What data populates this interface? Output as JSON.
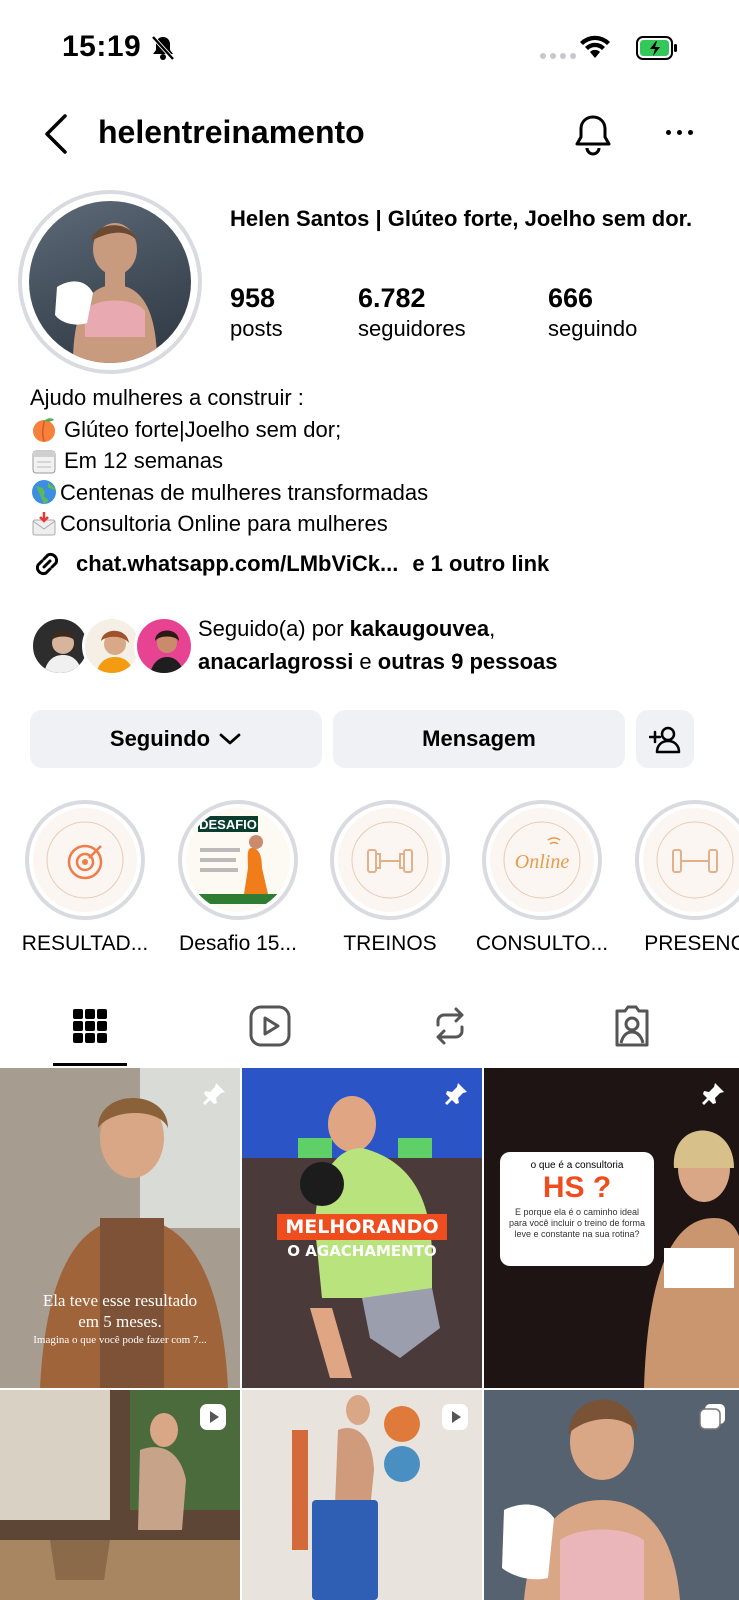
{
  "status_bar": {
    "time": "15:19"
  },
  "header": {
    "username": "helentreinamento"
  },
  "profile": {
    "display_name": "Helen Santos | Glúteo forte, Joelho sem dor.",
    "stats": [
      {
        "value": "958",
        "label": "posts"
      },
      {
        "value": "6.782",
        "label": "seguidores"
      },
      {
        "value": "666",
        "label": "seguindo"
      }
    ],
    "bio": [
      {
        "icon": "peach-emoji",
        "text": "Ajudo mulheres a construir :"
      },
      {
        "icon": "peach-emoji",
        "text": " Glúteo forte|Joelho sem dor;"
      },
      {
        "icon": "calendar-emoji",
        "text": " Em 12 semanas"
      },
      {
        "icon": "globe-emoji",
        "text": "Centenas de mulheres transformadas"
      },
      {
        "icon": "envelope-emoji",
        "text": "Consultoria Online para mulheres"
      }
    ],
    "link": "chat.whatsapp.com/LMbViCk...",
    "link_extra": "e 1 outro link"
  },
  "followed_by": {
    "prefix": "Seguido(a) por ",
    "user1": "kakaugouvea",
    "comma": ",",
    "user2": "anacarlagrossi",
    "middle": " e ",
    "others": "outras 9 pessoas"
  },
  "actions": {
    "following": "Seguindo",
    "message": "Mensagem"
  },
  "highlights": [
    {
      "label": "RESULTAD...",
      "text": "RESULTADO"
    },
    {
      "label": "Desafio 15...",
      "text": "DESAFIO"
    },
    {
      "label": "TREINOS",
      "text": "TREINOS"
    },
    {
      "label": "CONSULTO...",
      "text": "Online"
    },
    {
      "label": "PRESENC",
      "text": "TREINOS"
    }
  ],
  "grid": {
    "post1_caption": "Ela teve esse resultado em 5 meses.",
    "post1_sub": "Imagina o que você pode fazer com 7...",
    "post2_caption_1": "MELHORANDO",
    "post2_caption_2": "O AGACHAMENTO",
    "post3_q": "o que é a consultoria",
    "post3_title": "HS ?",
    "post3_body": "E porque ela é o caminho ideal para você incluir o treino de forma leve e constante na sua rotina?"
  },
  "colors": {
    "button_bg": "#eff1f5",
    "ring": "#d9dbe0",
    "accent_orange": "#f04d1f"
  }
}
